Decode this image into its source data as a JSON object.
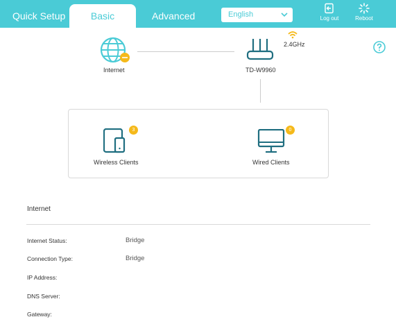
{
  "nav": {
    "tabs": [
      {
        "label": "Quick Setup",
        "active": false
      },
      {
        "label": "Basic",
        "active": true
      },
      {
        "label": "Advanced",
        "active": false
      }
    ],
    "language": "English",
    "logout_label": "Log out",
    "reboot_label": "Reboot"
  },
  "topology": {
    "internet_label": "Internet",
    "router_label": "TD-W9960",
    "wifi_band": "2.4GHz",
    "wireless_clients_label": "Wireless Clients",
    "wireless_clients_count": "3",
    "wired_clients_label": "Wired Clients",
    "wired_clients_count": "0"
  },
  "internet_info": {
    "title": "Internet",
    "rows": [
      {
        "label": "Internet Status:",
        "value": "Bridge"
      },
      {
        "label": "Connection Type:",
        "value": "Bridge"
      },
      {
        "label": "IP Address:",
        "value": ""
      },
      {
        "label": "DNS Server:",
        "value": ""
      },
      {
        "label": "Gateway:",
        "value": ""
      }
    ]
  },
  "colors": {
    "accent": "#4acbd6",
    "icon_dark": "#1f6e80",
    "badge": "#f5b91a"
  }
}
